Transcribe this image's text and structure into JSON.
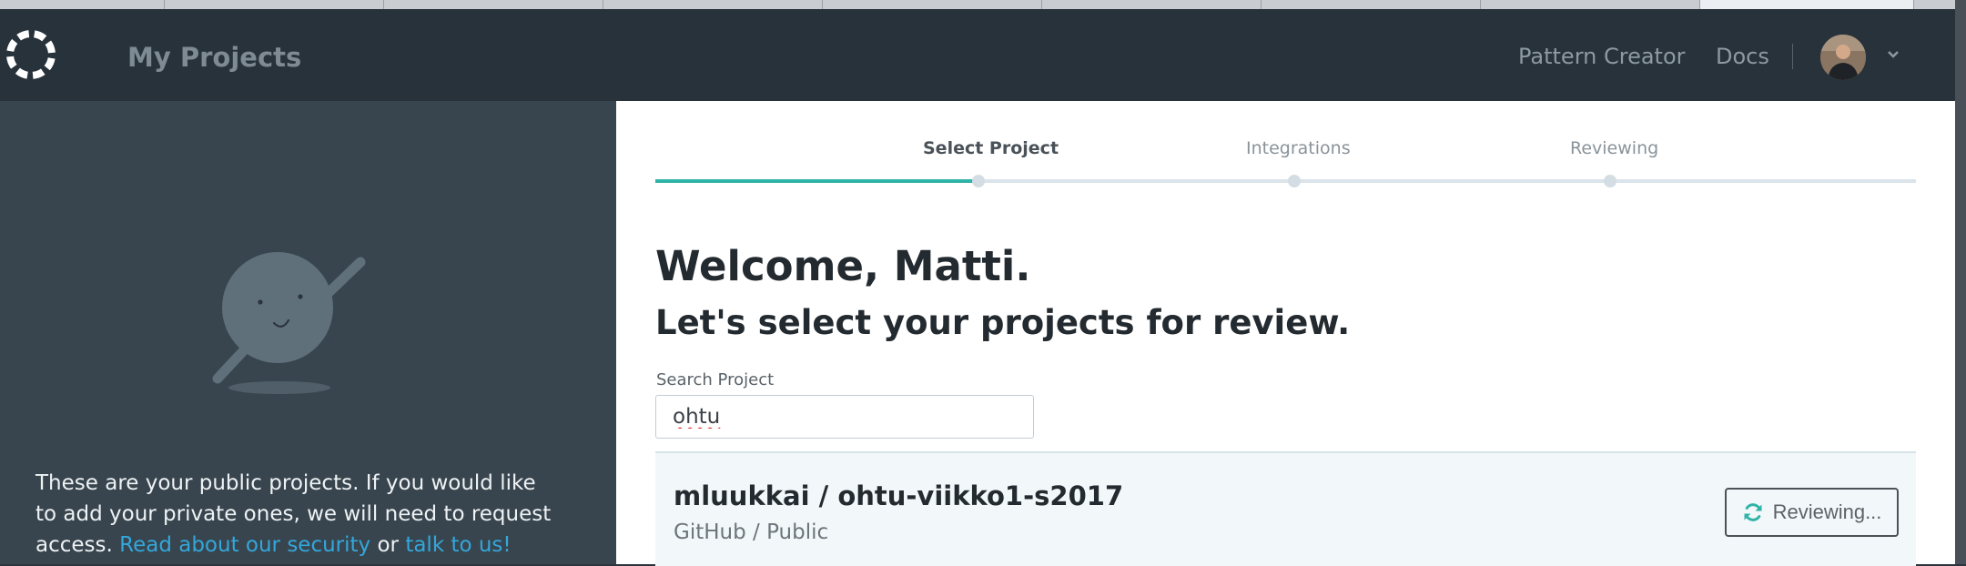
{
  "header": {
    "app_title": "My Projects",
    "nav": [
      "Pattern Creator",
      "Docs"
    ],
    "logo_icon": "loading-ring-icon",
    "avatar_icon": "user-avatar",
    "menu_icon": "chevron-down-icon"
  },
  "sidebar": {
    "illustration_icon": "waving-mascot-icon",
    "message": "These are your public projects. If you would like to add your private ones, we will need to request access.",
    "link_security": "Read about our security",
    "conjunction": "or",
    "link_contact": "talk to us!"
  },
  "steps": {
    "items": [
      "Select Project",
      "Integrations",
      "Reviewing"
    ],
    "current": "Select Project"
  },
  "main": {
    "welcome": "Welcome, Matti.",
    "subheading": "Let's select your projects for review.",
    "search": {
      "label": "Search Project",
      "value": "ohtu"
    }
  },
  "projects": [
    {
      "name": "mluukkai / ohtu-viikko1-s2017",
      "meta": "GitHub / Public",
      "status_label": "Reviewing...",
      "status_icon": "sync-icon"
    }
  ],
  "colors": {
    "topbar": "#27323a",
    "sidebar": "#38454e",
    "accent": "#30b3a7",
    "link": "#33a7db"
  }
}
